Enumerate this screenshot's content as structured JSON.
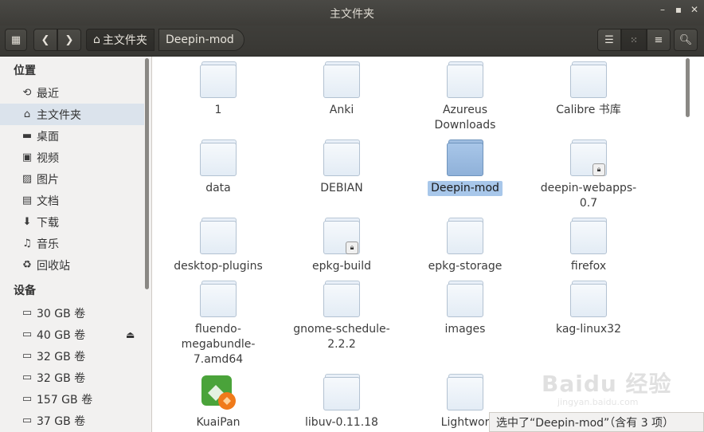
{
  "window": {
    "title": "主文件夹"
  },
  "toolbar": {
    "breadcrumbs": [
      {
        "label": "主文件夹"
      },
      {
        "label": "Deepin-mod"
      }
    ]
  },
  "sidebar": {
    "places_heading": "位置",
    "places": [
      {
        "label": "最近",
        "icon": "recent-icon"
      },
      {
        "label": "主文件夹",
        "icon": "home-icon"
      },
      {
        "label": "桌面",
        "icon": "desktop-folder-icon"
      },
      {
        "label": "视频",
        "icon": "video-icon"
      },
      {
        "label": "图片",
        "icon": "picture-icon"
      },
      {
        "label": "文档",
        "icon": "document-icon"
      },
      {
        "label": "下载",
        "icon": "download-icon"
      },
      {
        "label": "音乐",
        "icon": "music-icon"
      },
      {
        "label": "回收站",
        "icon": "trash-icon"
      }
    ],
    "devices_heading": "设备",
    "devices": [
      {
        "label": "30 GB 卷"
      },
      {
        "label": "40 GB 卷"
      },
      {
        "label": "32 GB 卷"
      },
      {
        "label": "32 GB 卷"
      },
      {
        "label": "157 GB 卷"
      },
      {
        "label": "37 GB 卷"
      }
    ]
  },
  "files": [
    {
      "name": "1"
    },
    {
      "name": "Anki"
    },
    {
      "name": "Azureus Downloads"
    },
    {
      "name": "Calibre 书库"
    },
    {
      "name": "data"
    },
    {
      "name": "DEBIAN"
    },
    {
      "name": "Deepin-mod",
      "selected": true
    },
    {
      "name": "deepin-webapps-0.7",
      "locked": true
    },
    {
      "name": "desktop-plugins"
    },
    {
      "name": "epkg-build",
      "locked": true
    },
    {
      "name": "epkg-storage"
    },
    {
      "name": "firefox"
    },
    {
      "name": "fluendo-megabundle-7.amd64"
    },
    {
      "name": "gnome-schedule-2.2.2"
    },
    {
      "name": "images"
    },
    {
      "name": "kag-linux32"
    },
    {
      "name": "KuaiPan"
    },
    {
      "name": "libuv-0.11.18"
    },
    {
      "name": "Lightwor"
    }
  ],
  "status_text": "选中了“Deepin-mod”（含有 3 项）",
  "watermark": {
    "text": "Baidu 经验",
    "sub": "jingyan.baidu.com"
  },
  "colors": {
    "selection": "#a8c7ea",
    "sidebar_selected": "#dbe3ec",
    "titlebar": "#3c3b37"
  }
}
